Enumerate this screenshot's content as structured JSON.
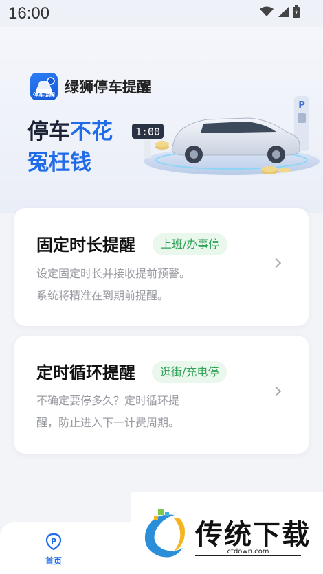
{
  "status_bar": {
    "time": "16:00"
  },
  "header": {
    "app_name": "绿狮停车提醒",
    "logo_text": "停车提醒",
    "slogan_line1_dark": "停车",
    "slogan_line1_blue": "不花",
    "slogan_line2": "冤枉钱",
    "meter_display": "1:00"
  },
  "cards": [
    {
      "title": "固定时长提醒",
      "tag": "上班/办事停",
      "desc_line1": "设定固定时长并接收提前预警。",
      "desc_line2": "系统将精准在到期前提醒。"
    },
    {
      "title": "定时循环提醒",
      "tag": "逛街/充电停",
      "desc_line1": "不确定要停多久？定时循环提",
      "desc_line2": "醒，防止进入下一计费周期。"
    }
  ],
  "tab_bar": {
    "home_label": "首页",
    "home_icon_letter": "P"
  },
  "watermark": {
    "text": "传统下载",
    "url": "ctdown.com"
  },
  "colors": {
    "accent": "#1f6be8",
    "tag_bg": "#e9f7ec",
    "tag_text": "#33a35a"
  },
  "icons": [
    "wifi-icon",
    "signal-icon",
    "battery-icon",
    "chevron-right-icon",
    "parking-home-icon"
  ]
}
